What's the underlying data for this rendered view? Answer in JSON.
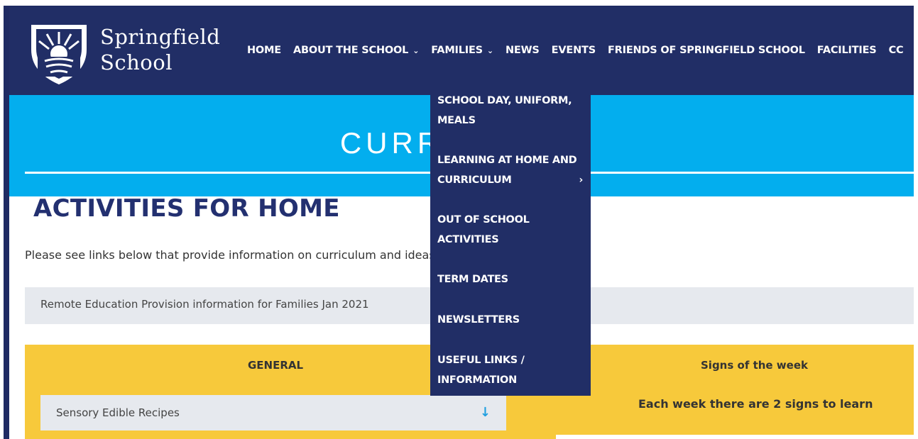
{
  "brand": {
    "line1": "Springfield",
    "line2": "School"
  },
  "nav": {
    "home": "HOME",
    "about": "ABOUT THE SCHOOL",
    "families": "FAMILIES",
    "news": "NEWS",
    "events": "EVENTS",
    "friends": "FRIENDS OF SPRINGFIELD SCHOOL",
    "facilities": "FACILITIES",
    "contact_partial": "CC"
  },
  "hero": {
    "title": "CURRICULUM"
  },
  "page": {
    "title": "ACTIVITIES FOR HOME",
    "intro": "Please see links below that provide information on curriculum and ideas for supporting your child:",
    "remote_link": "Remote Education Provision information for Families Jan 2021"
  },
  "general": {
    "heading": "GENERAL",
    "accordion_label": "Sensory Edible Recipes"
  },
  "signs": {
    "heading": "Signs of the week",
    "subtitle": "Each week there are 2 signs to learn"
  },
  "dropdown": {
    "item1": "SCHOOL DAY, UNIFORM, MEALS",
    "item2": "LEARNING AT HOME AND CURRICULUM",
    "item3": "OUT OF SCHOOL ACTIVITIES",
    "item4": "TERM DATES",
    "item5": "NEWSLETTERS",
    "item6": "USEFUL LINKS / INFORMATION"
  },
  "colors": {
    "navy": "#212e66",
    "sky": "#03aeee",
    "yellow": "#f7c93b",
    "grey": "#e6e9ee"
  }
}
